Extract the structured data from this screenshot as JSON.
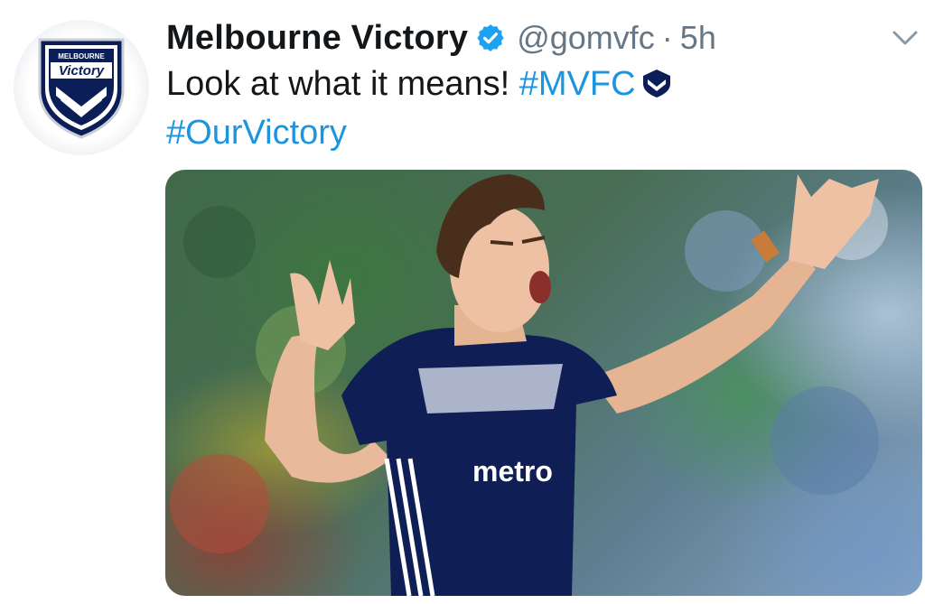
{
  "tweet": {
    "author_name": "Melbourne Victory",
    "handle": "@gomvfc",
    "separator": "·",
    "time": "5h",
    "text_plain": "Look at what it means! ",
    "hashtags": [
      "#MVFC",
      "#OurVictory"
    ],
    "avatar_logo_top": "MELBOURNE",
    "avatar_logo_main": "Victory",
    "icons": {
      "verified": "verified-badge-icon",
      "chevron": "chevron-down-icon",
      "club_emoji": "victory-crest-emoji-icon"
    },
    "media": {
      "jersey_sponsor": "metro"
    }
  },
  "colors": {
    "hashtag": "#1b95e0",
    "verified": "#1da1f2",
    "secondary_text": "#657786",
    "primary_text": "#14171a",
    "club_navy": "#0b1e57"
  }
}
